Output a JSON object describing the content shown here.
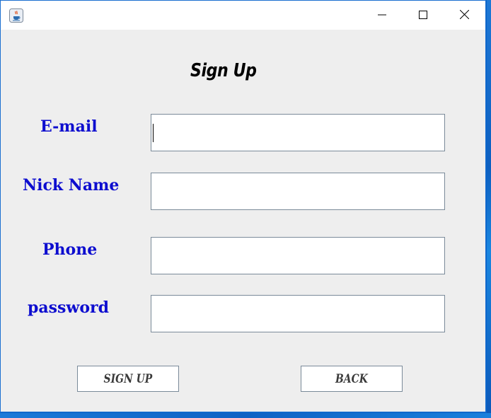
{
  "window": {
    "icon": "java-cup-icon",
    "controls": [
      "minimize-icon",
      "maximize-icon",
      "close-icon"
    ]
  },
  "form": {
    "heading": "Sign Up",
    "fields": {
      "email": {
        "label": "E-mail",
        "value": ""
      },
      "nickname": {
        "label": "Nick Name",
        "value": ""
      },
      "phone": {
        "label": "Phone",
        "value": ""
      },
      "password": {
        "label": "password",
        "value": ""
      }
    },
    "buttons": {
      "signup": "SIGN UP",
      "back": "BACK"
    }
  },
  "colors": {
    "label": "#0d0dcf",
    "window_bg": "#eeeeee",
    "desktop": "#0a64c8"
  }
}
